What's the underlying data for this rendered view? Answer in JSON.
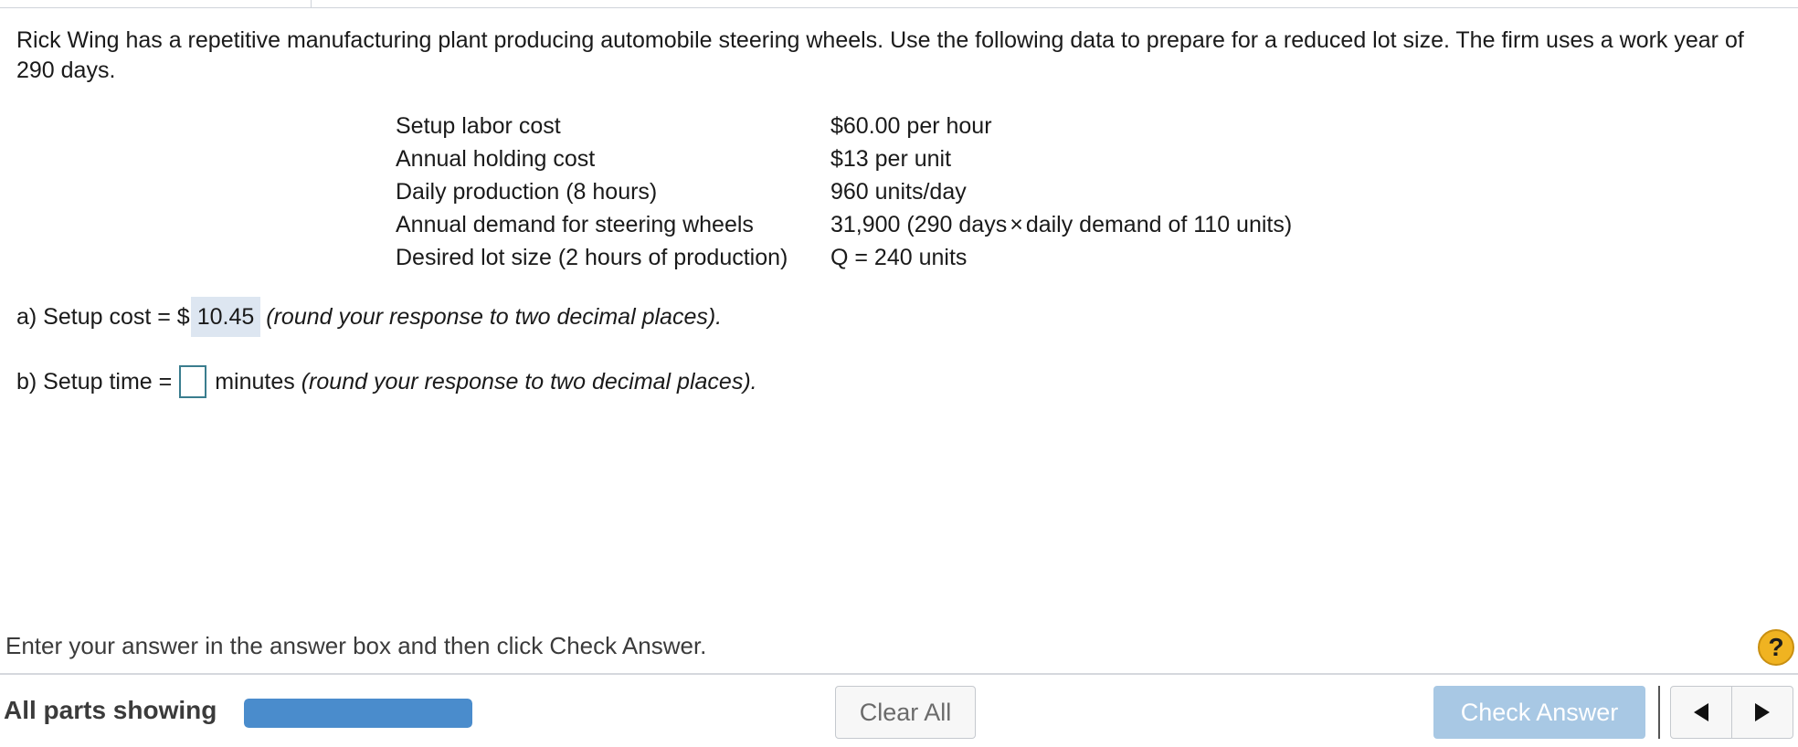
{
  "question": {
    "text": "Rick Wing has a repetitive manufacturing plant producing automobile steering wheels. Use the following data to prepare for a reduced lot size. The firm uses a work year of 290 days."
  },
  "data_table": {
    "rows": [
      {
        "label": "Setup labor cost",
        "value": "$60.00 per hour"
      },
      {
        "label": "Annual holding cost",
        "value": "$13 per unit"
      },
      {
        "label": "Daily production (8 hours)",
        "value": "960 units/day"
      },
      {
        "label": "Annual demand for steering wheels",
        "value_before": "31,900 (290 days",
        "value_symbol": "×",
        "value_after": "daily demand of 110 units)"
      },
      {
        "label": "Desired lot size (2 hours of production)",
        "value": "Q = 240 units"
      }
    ]
  },
  "part_a": {
    "prefix": "a) Setup cost = $",
    "answer": "10.45",
    "hint": "(round your response to two decimal places)."
  },
  "part_b": {
    "prefix": "b) Setup time =",
    "answer": "",
    "units": "minutes",
    "hint": "(round your response to two decimal places)."
  },
  "footer": {
    "instruction": "Enter your answer in the answer box and then click Check Answer.",
    "help_label": "?",
    "parts_label": "All parts showing",
    "progress": 1.0,
    "clear_all_label": "Clear All",
    "check_answer_label": "Check Answer"
  },
  "colors": {
    "accent": "#4a8ccc",
    "check_button_disabled": "#a8c8e4",
    "filled_answer_bg": "#dde6f1",
    "help_button": "#f0b321"
  }
}
